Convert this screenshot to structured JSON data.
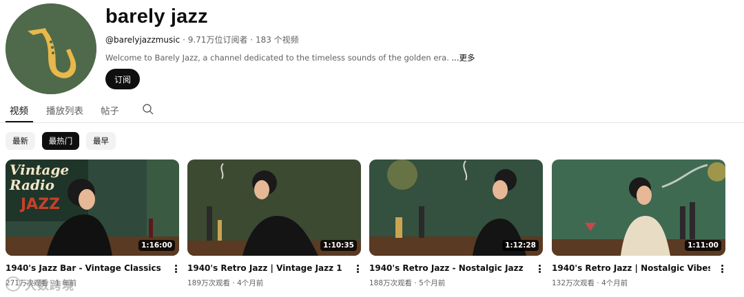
{
  "channel": {
    "name": "barely jazz",
    "handle": "@barelyjazzmusic",
    "subscribers": "9.71万位订阅者",
    "video_count": "183 个视频",
    "meta_separator": "·",
    "description": "Welcome to Barely Jazz, a channel dedicated to the timeless sounds of the golden era.",
    "more_label": "...更多",
    "subscribe_label": "订阅",
    "avatar_icon": "saxophone-icon",
    "avatar_color": "#4f6a4a",
    "avatar_icon_color": "#e8b84a"
  },
  "tabs": [
    {
      "label": "视频",
      "active": true
    },
    {
      "label": "播放列表",
      "active": false
    },
    {
      "label": "帖子",
      "active": false
    }
  ],
  "search_icon": "search-icon",
  "chips": [
    {
      "label": "最新",
      "selected": false
    },
    {
      "label": "最热门",
      "selected": true
    },
    {
      "label": "最早",
      "selected": false
    }
  ],
  "videos": [
    {
      "title": "1940's Jazz Bar - Vintage Classics",
      "duration": "1:16:00",
      "views": "271万次观看",
      "age": "1 年前",
      "thumb_text": [
        "Vintage",
        "Radio",
        "JAZZ"
      ]
    },
    {
      "title": "1940's Retro Jazz | Vintage Jazz 1",
      "duration": "1:10:35",
      "views": "189万次观看",
      "age": "4个月前"
    },
    {
      "title": "1940's Retro Jazz - Nostalgic Jazz",
      "duration": "1:12:28",
      "views": "188万次观看",
      "age": "5个月前"
    },
    {
      "title": "1940's Retro Jazz | Nostalgic Vibes",
      "duration": "1:11:00",
      "views": "132万次观看",
      "age": "4个月前"
    }
  ],
  "meta_separator": "·",
  "watermark": {
    "text": "大数跨境",
    "icon": "watermark-logo-icon"
  }
}
